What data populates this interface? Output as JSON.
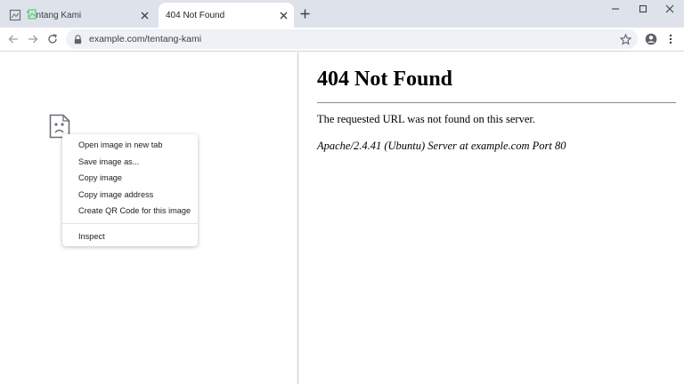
{
  "browser": {
    "tabs": [
      {
        "title": "Tentang Kami",
        "active": false
      },
      {
        "title": "404 Not Found",
        "active": true
      }
    ],
    "address_url": "example.com/tentang-kami"
  },
  "context_menu": {
    "items": [
      "Open image in new tab",
      "Save image as...",
      "Copy image",
      "Copy image address",
      "Create QR Code for this image"
    ],
    "inspect_label": "Inspect"
  },
  "error_page": {
    "title": "404 Not Found",
    "message": "The requested URL was not found on this server.",
    "server_signature": "Apache/2.4.41 (Ubuntu) Server at example.com Port 80"
  },
  "icons": {
    "tab_favicon": "broken-image-icon",
    "drag_ghost": "image-drag-icon",
    "close": "close-icon",
    "new_tab": "plus-icon",
    "minimize": "minimize-icon",
    "maximize": "maximize-icon",
    "window_close": "close-icon",
    "back": "arrow-left-icon",
    "forward": "arrow-right-icon",
    "reload": "reload-icon",
    "lock": "lock-icon",
    "bookmark": "star-icon",
    "profile": "account-circle-icon",
    "menu": "kebab-menu-icon"
  },
  "colors": {
    "tabstrip_bg": "#dee3eb",
    "omnibox_bg": "#eef1f6",
    "drag_ghost_green": "#5bb974"
  }
}
